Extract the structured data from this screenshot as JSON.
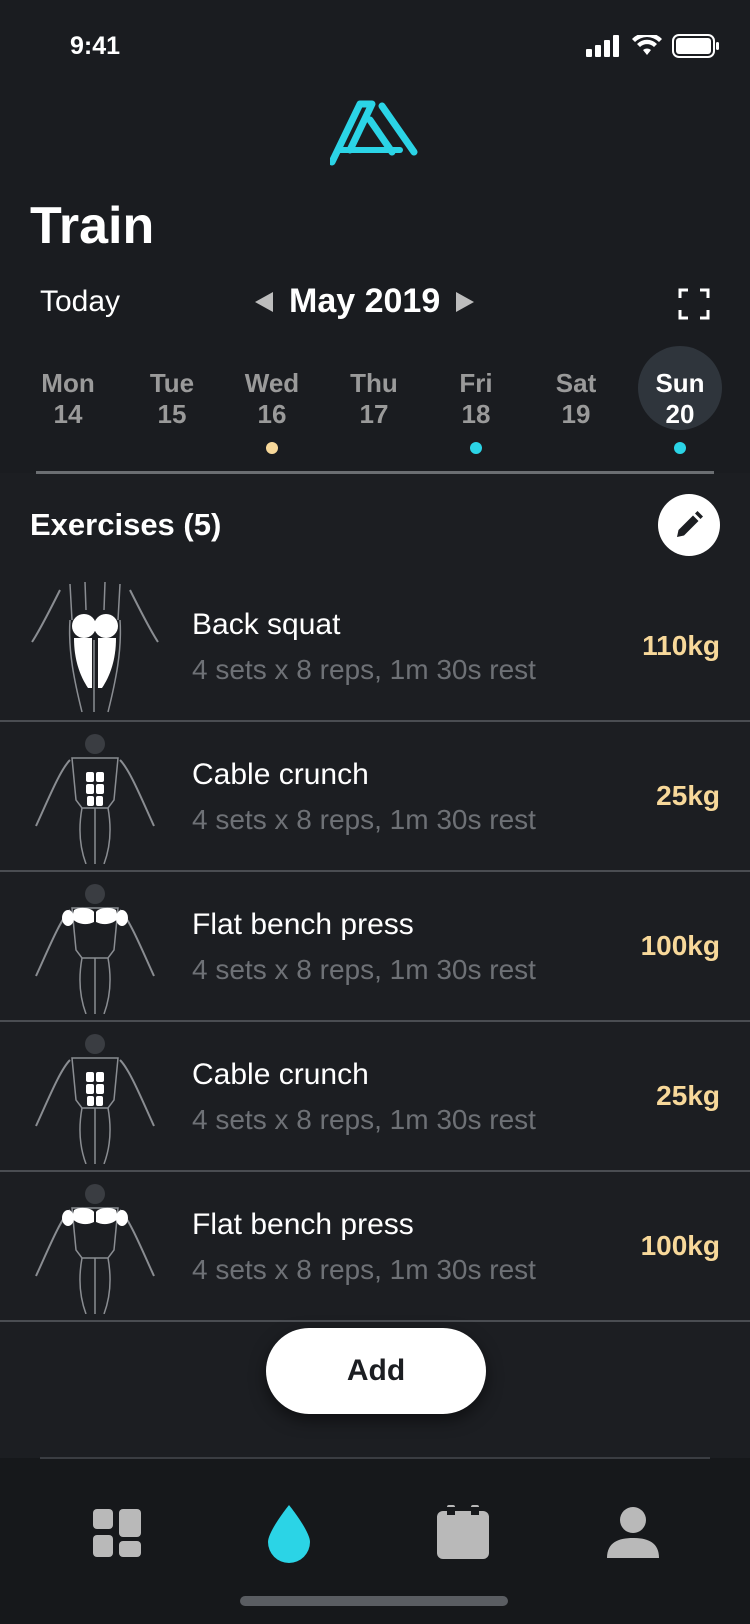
{
  "status_bar": {
    "time": "9:41"
  },
  "header": {
    "title": "Train",
    "today_label": "Today",
    "month_label": "May 2019"
  },
  "colors": {
    "accent": "#2bd4e6",
    "weight": "#f7d89a",
    "dot_yellow": "#f7d89a",
    "dot_cyan": "#2bd4e6"
  },
  "days": [
    {
      "name": "Mon",
      "num": "14",
      "dot": ""
    },
    {
      "name": "Tue",
      "num": "15",
      "dot": ""
    },
    {
      "name": "Wed",
      "num": "16",
      "dot": "yellow"
    },
    {
      "name": "Thu",
      "num": "17",
      "dot": ""
    },
    {
      "name": "Fri",
      "num": "18",
      "dot": "cyan"
    },
    {
      "name": "Sat",
      "num": "19",
      "dot": ""
    },
    {
      "name": "Sun",
      "num": "20",
      "dot": "cyan",
      "selected": true
    }
  ],
  "exercises_section": {
    "title": "Exercises (5)"
  },
  "exercises": [
    {
      "name": "Back squat",
      "detail": "4 sets x 8 reps, 1m 30s rest",
      "weight": "110kg",
      "muscle": "legs"
    },
    {
      "name": "Cable crunch",
      "detail": "4 sets x 8 reps, 1m 30s rest",
      "weight": "25kg",
      "muscle": "abs"
    },
    {
      "name": "Flat bench press",
      "detail": "4 sets x 8 reps, 1m 30s rest",
      "weight": "100kg",
      "muscle": "chest"
    },
    {
      "name": "Cable crunch",
      "detail": "4 sets x 8 reps, 1m 30s rest",
      "weight": "25kg",
      "muscle": "abs"
    },
    {
      "name": "Flat bench press",
      "detail": "4 sets x 8 reps, 1m 30s rest",
      "weight": "100kg",
      "muscle": "chest"
    }
  ],
  "add_button": {
    "label": "Add"
  },
  "tabs": [
    {
      "icon": "dashboard-icon"
    },
    {
      "icon": "drop-icon",
      "active": true
    },
    {
      "icon": "calendar-icon"
    },
    {
      "icon": "profile-icon"
    }
  ]
}
